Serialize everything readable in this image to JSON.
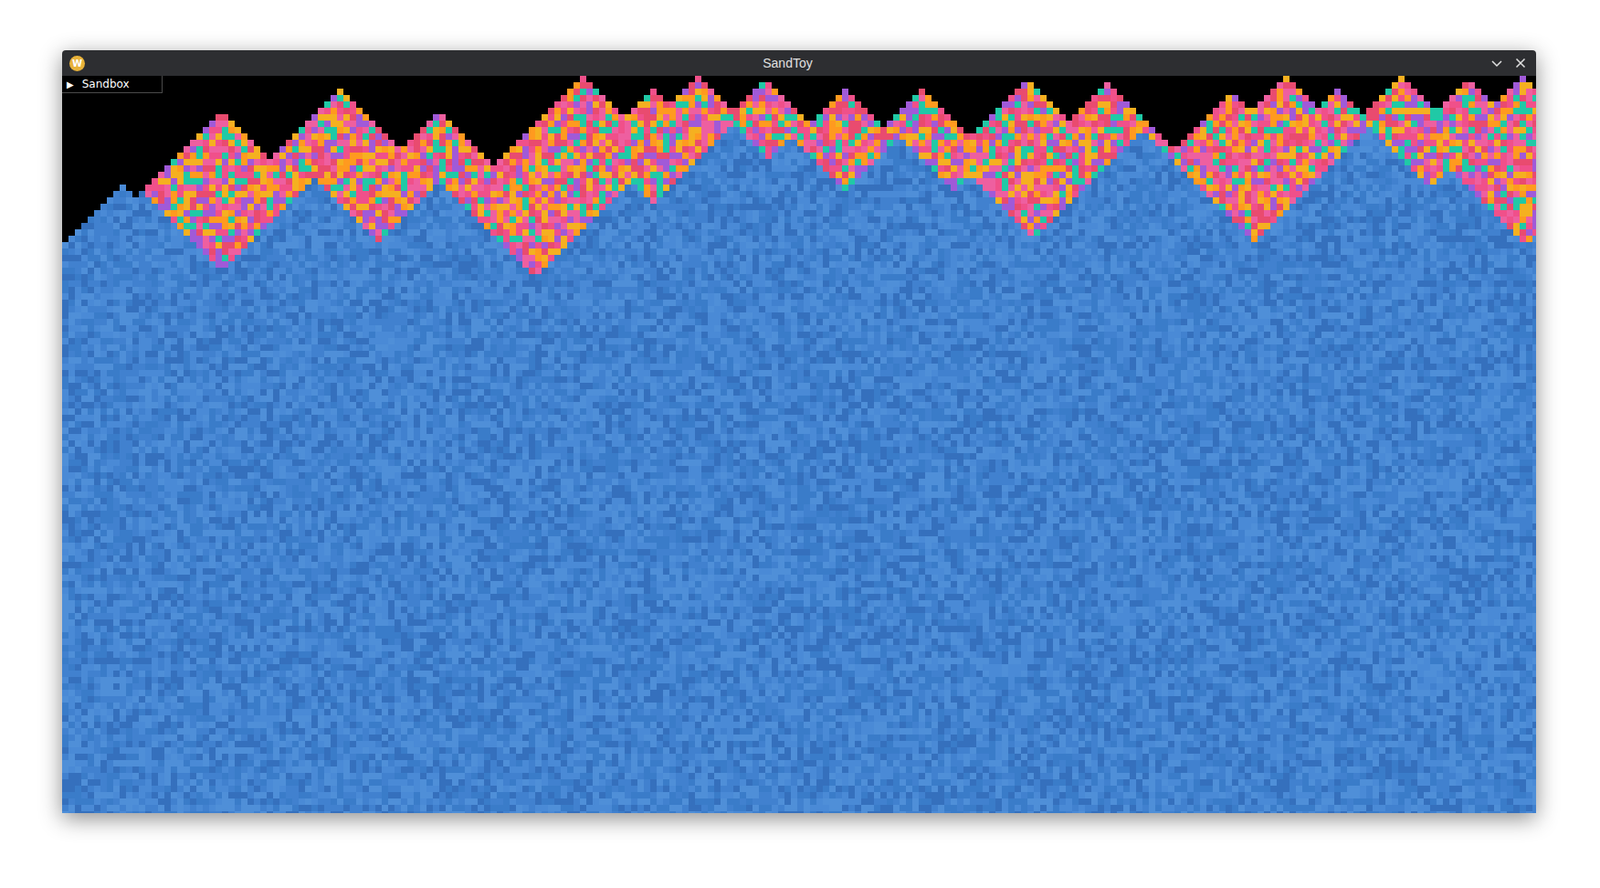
{
  "window": {
    "title": "SandToy",
    "logo": "W"
  },
  "panel": {
    "toggle": "▶",
    "label": "Sandbox",
    "expanded": false
  }
}
